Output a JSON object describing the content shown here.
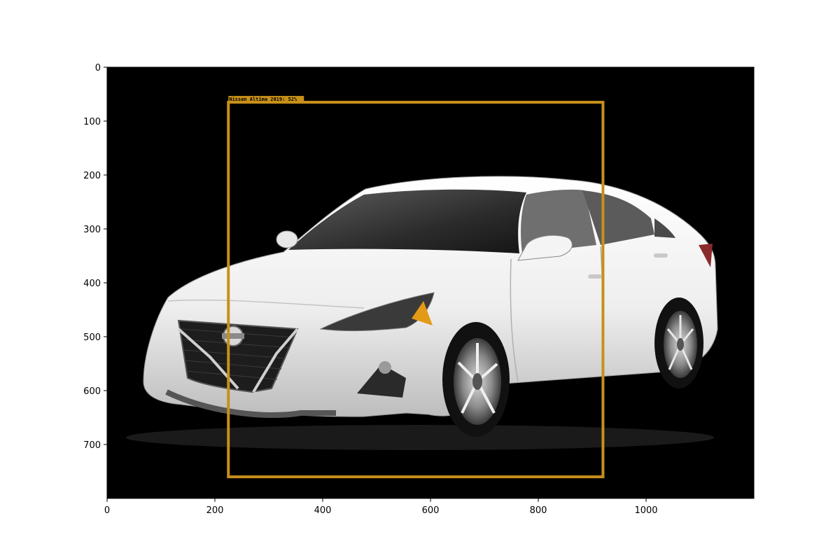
{
  "image": {
    "width": 1200,
    "height": 800,
    "background": "#000000",
    "subject": "white sedan"
  },
  "axes": {
    "x_ticks": [
      0,
      200,
      400,
      600,
      800,
      1000
    ],
    "y_ticks": [
      0,
      100,
      200,
      300,
      400,
      500,
      600,
      700
    ]
  },
  "detection": {
    "label": "Nissan Altima 2019: 52%",
    "color": "#c8901a",
    "box": {
      "x_min": 225,
      "y_min": 65,
      "x_max": 920,
      "y_max": 760
    }
  }
}
